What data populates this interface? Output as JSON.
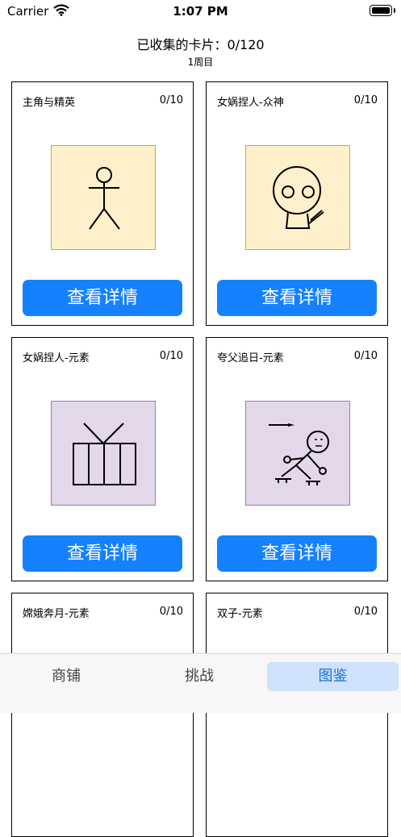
{
  "status_bar": {
    "carrier": "Carrier",
    "time": "1:07 PM"
  },
  "header": {
    "title": "已收集的卡片：0/120",
    "subtitle": "1周目"
  },
  "cards": [
    {
      "name": "主角与精英",
      "count": "0/10",
      "button": "查看详情",
      "art_icon": "stick-figure-icon",
      "art_bg": "#fff0cc"
    },
    {
      "name": "女娲捏人-众神",
      "count": "0/10",
      "button": "查看详情",
      "art_icon": "round-face-icon",
      "art_bg": "#fff0cc"
    },
    {
      "name": "女娲捏人-元素",
      "count": "0/10",
      "button": "查看详情",
      "art_icon": "tv-cage-icon",
      "art_bg": "#e3d8ea"
    },
    {
      "name": "夸父追日-元素",
      "count": "0/10",
      "button": "查看详情",
      "art_icon": "runner-icon",
      "art_bg": "#e3d8ea"
    },
    {
      "name": "嫦娥奔月-元素",
      "count": "0/10"
    },
    {
      "name": "双子-元素",
      "count": "0/10"
    }
  ],
  "tabbar": {
    "tabs": [
      "商铺",
      "挑战",
      "图鉴"
    ],
    "active_index": 2,
    "active_color": "#1a6fd8"
  }
}
